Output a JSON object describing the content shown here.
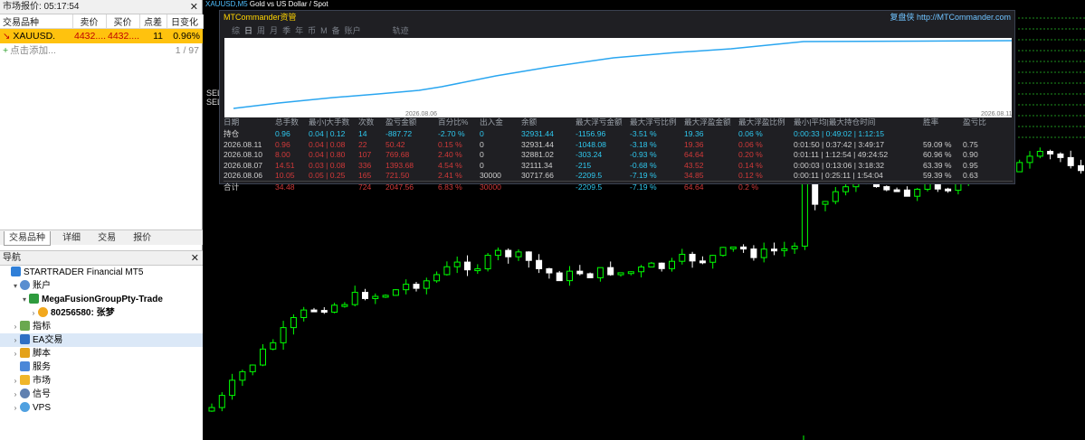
{
  "market_watch": {
    "title": "市场报价: 05:17:54",
    "columns": [
      "交易品种",
      "卖价",
      "买价",
      "点差",
      "日变化"
    ],
    "rows": [
      {
        "symbol": "XAUUSD.",
        "bid": "4432....",
        "ask": "4432....",
        "spread": "11",
        "change": "0.96%"
      }
    ],
    "add_label": "点击添加...",
    "count": "1 / 97",
    "tabs": [
      "交易品种",
      "详细",
      "交易",
      "报价"
    ]
  },
  "navigator": {
    "title": "导航",
    "items": [
      {
        "label": "STARTRADER Financial MT5",
        "icon": "broker-icon",
        "indent": 0,
        "toggle": ""
      },
      {
        "label": "账户",
        "icon": "accounts-icon",
        "indent": 1,
        "toggle": "v"
      },
      {
        "label": "MegaFusionGroupPty-Trade",
        "icon": "server-icon",
        "indent": 2,
        "toggle": "v",
        "bold": true
      },
      {
        "label": "80256580: 张梦",
        "icon": "user-icon",
        "indent": 3,
        "toggle": ">",
        "bold": true
      },
      {
        "label": "指标",
        "icon": "indicators-icon",
        "indent": 1,
        "toggle": ">"
      },
      {
        "label": "EA交易",
        "icon": "expert-icon",
        "indent": 1,
        "toggle": ">",
        "selected": true
      },
      {
        "label": "脚本",
        "icon": "scripts-icon",
        "indent": 1,
        "toggle": ">"
      },
      {
        "label": "服务",
        "icon": "services-icon",
        "indent": 1,
        "toggle": ""
      },
      {
        "label": "市场",
        "icon": "market-icon",
        "indent": 1,
        "toggle": ">"
      },
      {
        "label": "信号",
        "icon": "signals-icon",
        "indent": 1,
        "toggle": ">"
      },
      {
        "label": "VPS",
        "icon": "vps-icon",
        "indent": 1,
        "toggle": ">"
      }
    ]
  },
  "chart": {
    "header_symbol": "XAUUSD,M5",
    "header_desc": "Gold vs US Dollar / Spot",
    "side_labels": [
      "SEL",
      "SEL"
    ],
    "bull_color": "#00ff00",
    "bear_color": "#ffffff"
  },
  "mtc": {
    "title": "MTCommander资管",
    "site": "复盘侠 http://MTCommander.com",
    "tabs": [
      "综",
      "日",
      "周",
      "月",
      "季",
      "年",
      "币",
      "M",
      "备",
      "账户",
      "轨迹"
    ],
    "active_tab": "日",
    "equity_start_label": "2026.08.06",
    "equity_end_label": "2026.08.11",
    "line_color": "#2aa6f0",
    "columns": [
      "日期",
      "总手数",
      "最小|大手数",
      "次数",
      "盈亏金额",
      "百分比%",
      "出入金",
      "余额",
      "最大浮亏金额",
      "最大浮亏比例",
      "最大浮盈金额",
      "最大浮盈比例",
      "最小|平均|最大持仓时间",
      "胜率",
      "盈亏比"
    ],
    "holding": [
      "持仓",
      "0.96",
      "0.04 | 0.12",
      "14",
      "-887.72",
      "-2.70 %",
      "0",
      "32931.44",
      "-1156.96",
      "-3.51 %",
      "19.36",
      "0.06 %",
      "0:00:33 | 0:49:02 | 1:12:15",
      "",
      ""
    ],
    "rows": [
      [
        "2026.08.11",
        "0.96",
        "0.04 | 0.08",
        "22",
        "50.42",
        "0.15 %",
        "0",
        "32931.44",
        "-1048.08",
        "-3.18 %",
        "19.36",
        "0.06 %",
        "0:01:50 | 0:37:42 | 3:49:17",
        "59.09 %",
        "0.75"
      ],
      [
        "2026.08.10",
        "8.00",
        "0.04 | 0.80",
        "107",
        "769.68",
        "2.40 %",
        "0",
        "32881.02",
        "-303.24",
        "-0.93 %",
        "64.64",
        "0.20 %",
        "0:01:11 | 1:12:54 | 49:24:52",
        "60.96 %",
        "0.90"
      ],
      [
        "2026.08.07",
        "14.51",
        "0.03 | 0.08",
        "336",
        "1393.68",
        "4.54 %",
        "0",
        "32111.34",
        "-215",
        "-0.68 %",
        "43.52",
        "0.14 %",
        "0:00:03 | 0:13:06 | 3:18:32",
        "63.39 %",
        "0.95"
      ],
      [
        "2026.08.06",
        "10.05",
        "0.05 | 0.25",
        "165",
        "721.50",
        "2.41 %",
        "30000",
        "30717.66",
        "-2209.5",
        "-7.19 %",
        "34.85",
        "0.12 %",
        "0:00:11 | 0:25:11 | 1:54:04",
        "59.39 %",
        "0.63"
      ]
    ],
    "total": [
      "合计",
      "34.48",
      "",
      "724",
      "2047.56",
      "6.83 %",
      "30000",
      "",
      "-2209.5",
      "-7.19 %",
      "64.64",
      "0.2 %",
      "",
      "",
      ""
    ]
  }
}
